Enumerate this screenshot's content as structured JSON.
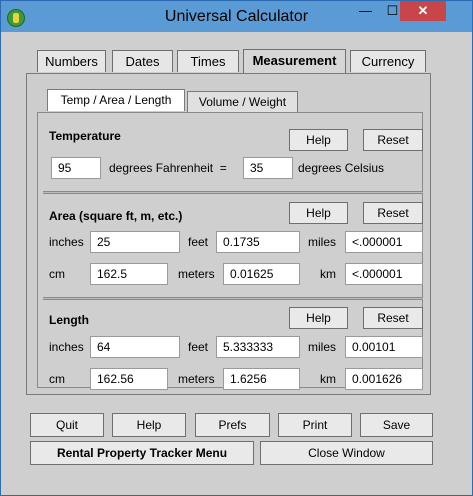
{
  "window": {
    "title": "Universal Calculator",
    "minimize": "—",
    "maximize": "☐",
    "close": "✕"
  },
  "tabs": [
    {
      "label": "Numbers"
    },
    {
      "label": "Dates"
    },
    {
      "label": "Times"
    },
    {
      "label": "Measurement"
    },
    {
      "label": "Currency"
    }
  ],
  "subtabs": [
    {
      "label": "Temp / Area / Length"
    },
    {
      "label": "Volume / Weight"
    }
  ],
  "temperature": {
    "title": "Temperature",
    "help": "Help",
    "reset": "Reset",
    "fahrenheit_value": "95",
    "fahrenheit_label": "degrees Fahrenheit  =",
    "celsius_value": "35",
    "celsius_label": "degrees Celsius"
  },
  "area": {
    "title": "Area (square ft, m, etc.)",
    "help": "Help",
    "reset": "Reset",
    "inches_label": "inches",
    "inches_value": "25",
    "feet_label": "feet",
    "feet_value": "0.1735",
    "miles_label": "miles",
    "miles_value": "<.000001",
    "cm_label": "cm",
    "cm_value": "162.5",
    "meters_label": "meters",
    "meters_value": "0.01625",
    "km_label": "km",
    "km_value": "<.000001"
  },
  "length": {
    "title": "Length",
    "help": "Help",
    "reset": "Reset",
    "inches_label": "inches",
    "inches_value": "64",
    "feet_label": "feet",
    "feet_value": "5.333333",
    "miles_label": "miles",
    "miles_value": "0.00101",
    "cm_label": "cm",
    "cm_value": "162.56",
    "meters_label": "meters",
    "meters_value": "1.6256",
    "km_label": "km",
    "km_value": "0.001626"
  },
  "bottom": {
    "quit": "Quit",
    "help": "Help",
    "prefs": "Prefs",
    "print": "Print",
    "save": "Save",
    "menu": "Rental Property Tracker Menu",
    "close_window": "Close Window"
  }
}
